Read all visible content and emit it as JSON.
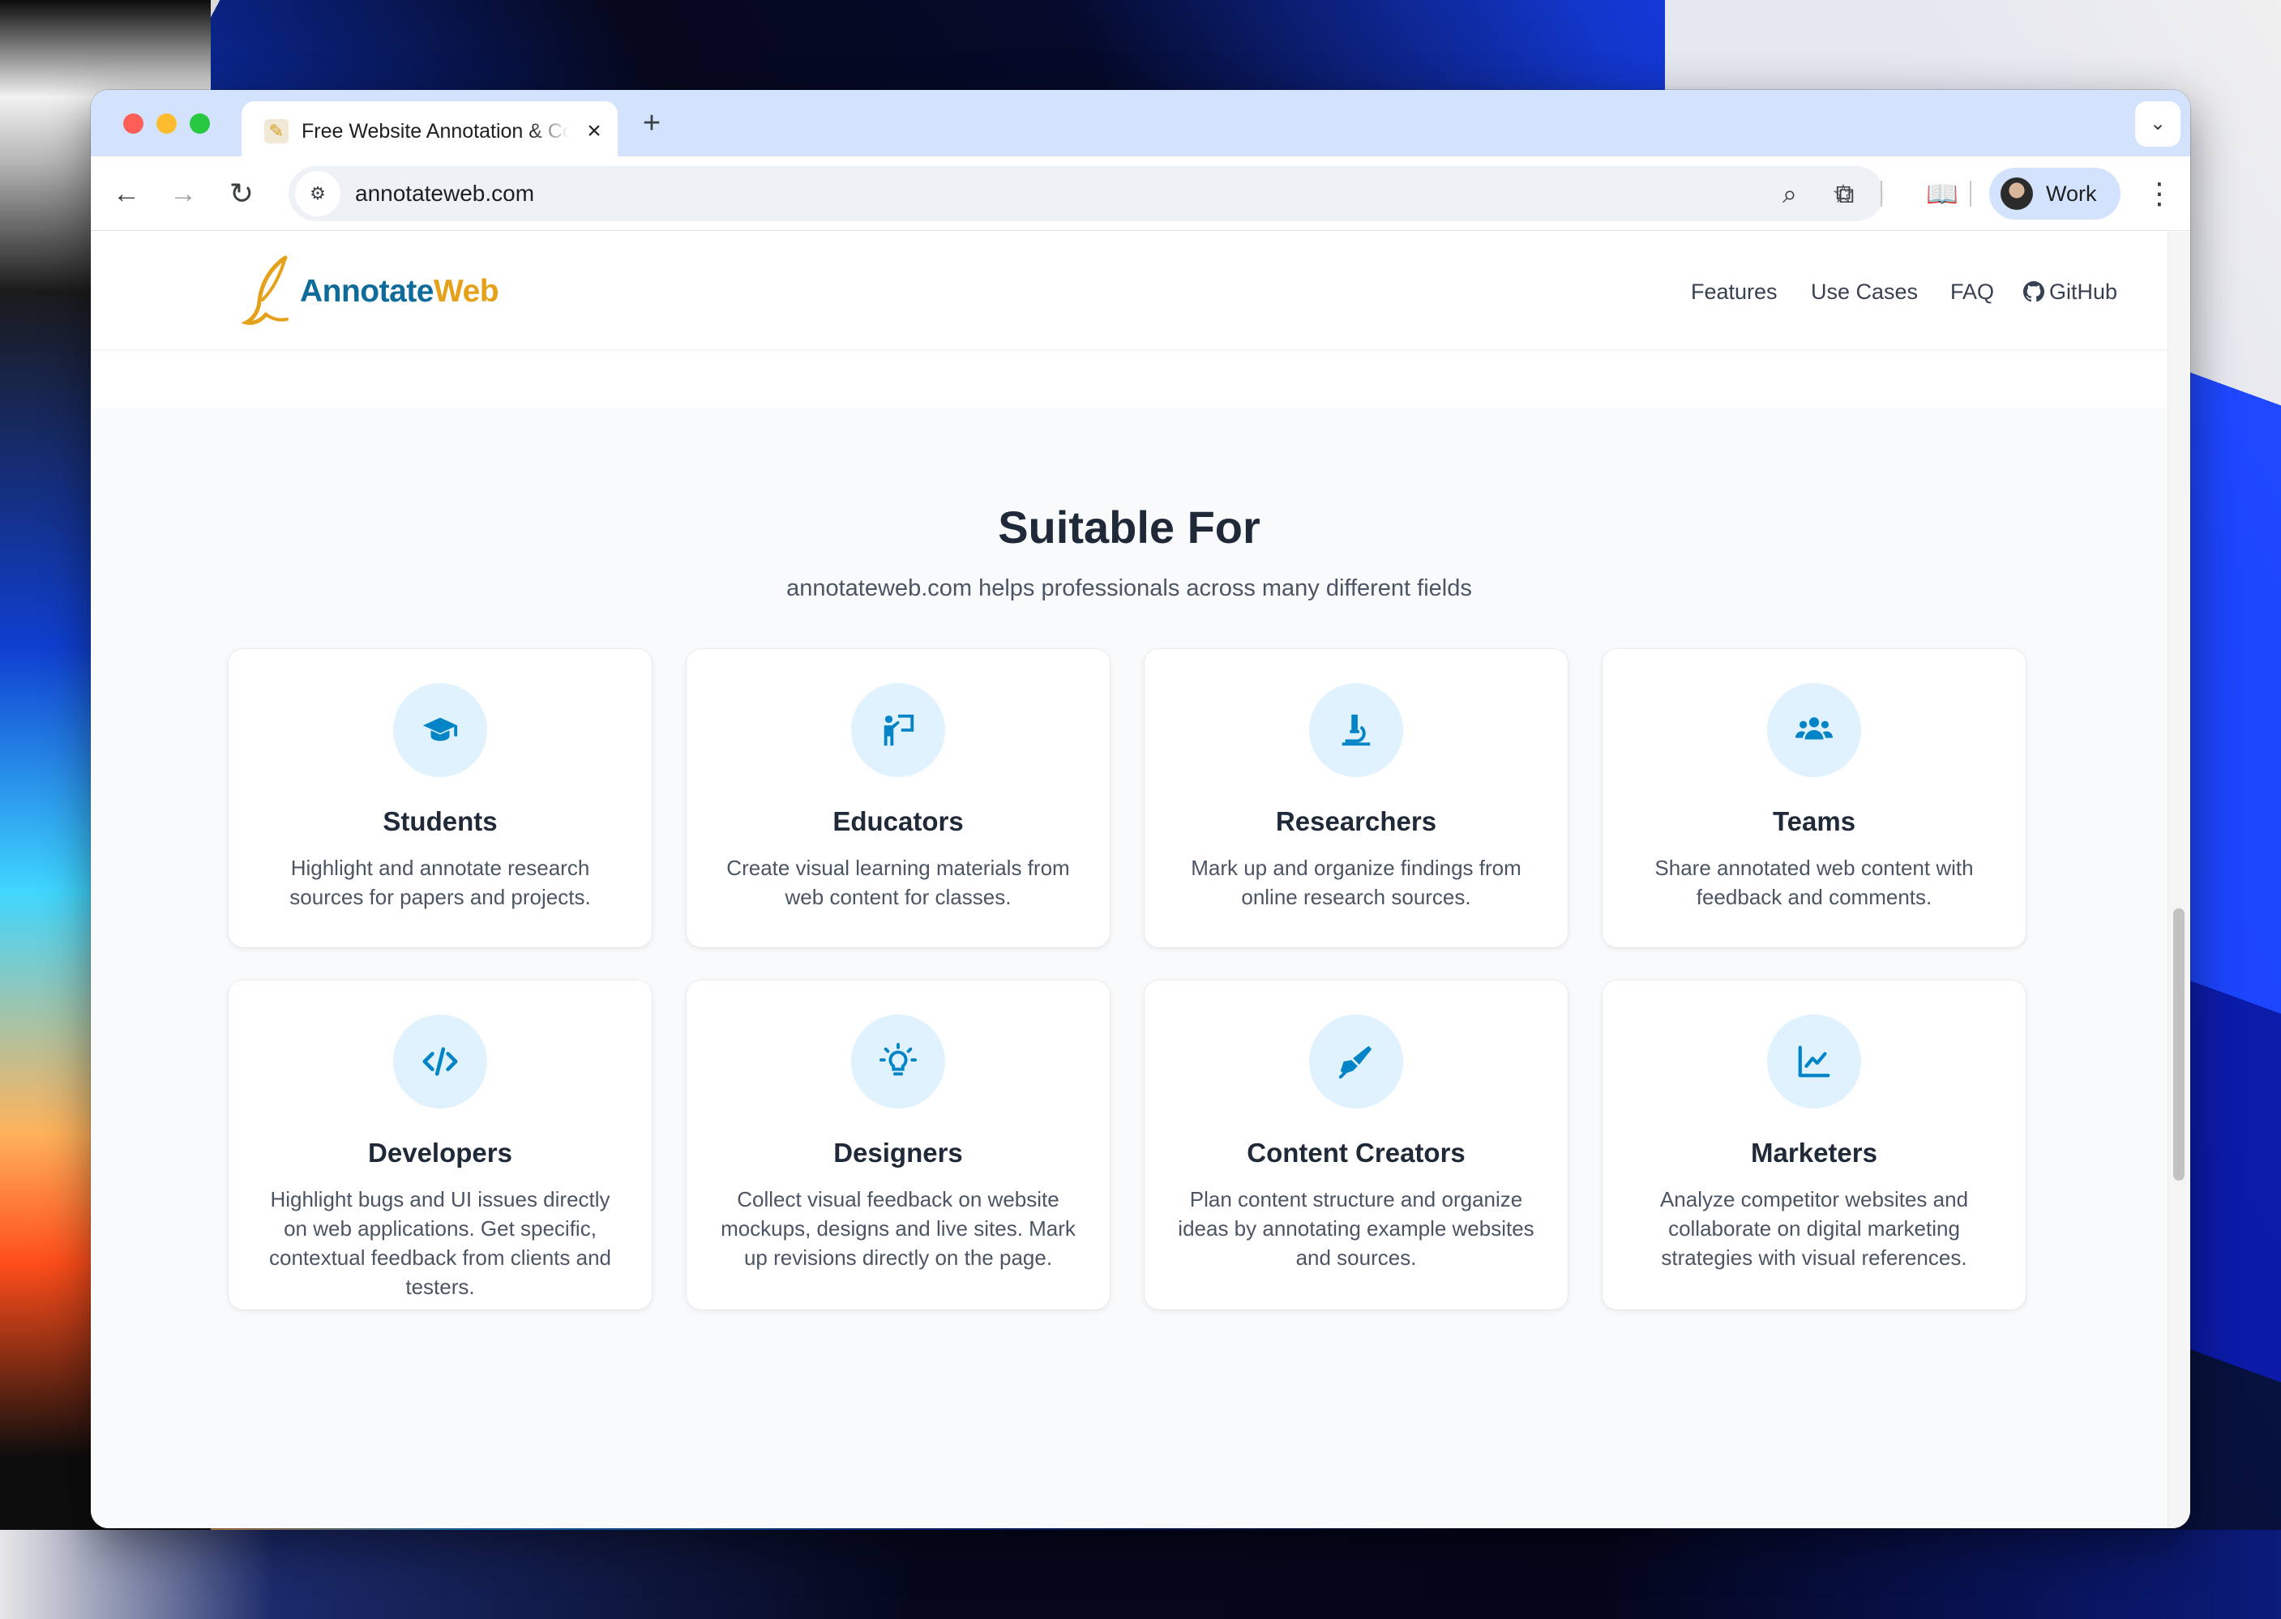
{
  "browser": {
    "tab_title": "Free Website Annotation & Co",
    "url": "annotateweb.com",
    "profile_label": "Work"
  },
  "site": {
    "logo_primary": "Annotate",
    "logo_secondary": "Web",
    "nav": [
      "Features",
      "Use Cases",
      "FAQ",
      "GitHub"
    ]
  },
  "section": {
    "title": "Suitable For",
    "subtitle": "annotateweb.com helps professionals across many different fields"
  },
  "colors": {
    "accent": "#0f6b99",
    "brand_gold": "#e6a11b",
    "icon_bg": "#e0f2fe",
    "icon_fg": "#0284c7"
  },
  "cards": [
    {
      "icon": "graduation-cap-icon",
      "title": "Students",
      "desc": "Highlight and annotate research sources for papers and projects."
    },
    {
      "icon": "teacher-board-icon",
      "title": "Educators",
      "desc": "Create visual learning materials from web content for classes."
    },
    {
      "icon": "microscope-icon",
      "title": "Researchers",
      "desc": "Mark up and organize findings from online research sources."
    },
    {
      "icon": "users-icon",
      "title": "Teams",
      "desc": "Share annotated web content with feedback and comments."
    },
    {
      "icon": "code-icon",
      "title": "Developers",
      "desc": "Highlight bugs and UI issues directly on web applications. Get specific, contextual feedback from clients and testers."
    },
    {
      "icon": "lightbulb-icon",
      "title": "Designers",
      "desc": "Collect visual feedback on website mockups, designs and live sites. Mark up revisions directly on the page."
    },
    {
      "icon": "pen-nib-icon",
      "title": "Content Creators",
      "desc": "Plan content structure and organize ideas by annotating example websites and sources."
    },
    {
      "icon": "chart-line-icon",
      "title": "Marketers",
      "desc": "Analyze competitor websites and collaborate on digital marketing strategies with visual references."
    }
  ]
}
